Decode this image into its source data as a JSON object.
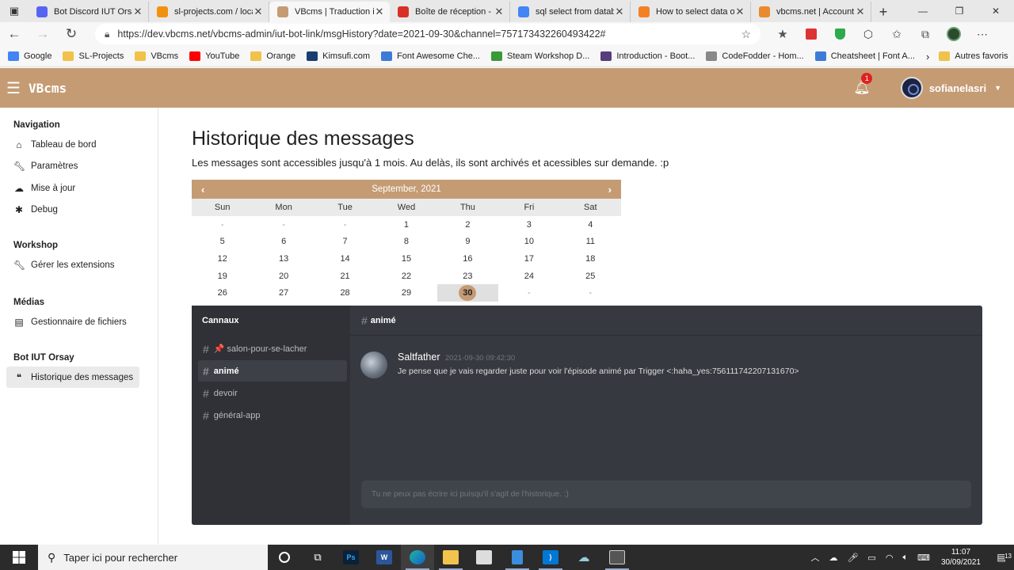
{
  "browser": {
    "tabs": [
      {
        "title": "Bot Discord IUT Orsay",
        "icon": "discord-icon",
        "color": "#5865f2",
        "active": false
      },
      {
        "title": "sl-projects.com / localhost",
        "icon": "phpmyadmin-icon",
        "color": "#f29111",
        "active": false
      },
      {
        "title": "VBcms | Traduction in",
        "icon": "vbcms-icon",
        "color": "#c59b74",
        "active": true
      },
      {
        "title": "Boîte de réception - a",
        "icon": "gmail-icon",
        "color": "#d93025",
        "active": false
      },
      {
        "title": "sql select from datab",
        "icon": "google-icon",
        "color": "#4285f4",
        "active": false
      },
      {
        "title": "How to select data of",
        "icon": "stackoverflow-icon",
        "color": "#f48024",
        "active": false
      },
      {
        "title": "vbcms.net | Account",
        "icon": "vbcms-net-icon",
        "color": "#e98a2f",
        "active": false
      }
    ],
    "url": "https://dev.vbcms.net/vbcms-admin/iut-bot-link/msgHistory?date=2021-09-30&channel=757173432260493422#",
    "bookmarks": [
      {
        "label": "Google",
        "icon": "google-icon"
      },
      {
        "label": "SL-Projects",
        "icon": "folder-icon"
      },
      {
        "label": "VBcms",
        "icon": "folder-icon"
      },
      {
        "label": "YouTube",
        "icon": "youtube-icon"
      },
      {
        "label": "Orange",
        "icon": "folder-icon"
      },
      {
        "label": "Kimsufi.com",
        "icon": "kimsufi-icon"
      },
      {
        "label": "Font Awesome Che...",
        "icon": "flag-icon"
      },
      {
        "label": "Steam Workshop D...",
        "icon": "steam-icon"
      },
      {
        "label": "Introduction - Boot...",
        "icon": "bootstrap-icon"
      },
      {
        "label": "CodeFodder - Hom...",
        "icon": "codefodder-icon"
      },
      {
        "label": "Cheatsheet | Font A...",
        "icon": "flag-icon"
      }
    ],
    "other_bookmarks": "Autres favoris"
  },
  "app": {
    "brand": "VBcms",
    "notification_count": "1",
    "username": "sofianelasri",
    "accent_color": "#c59b74"
  },
  "sidebar": {
    "sections": [
      {
        "title": "Navigation",
        "items": [
          {
            "label": "Tableau de bord",
            "icon": "home-icon"
          },
          {
            "label": "Paramètres",
            "icon": "wrench-icon"
          },
          {
            "label": "Mise à jour",
            "icon": "cloud-download-icon"
          },
          {
            "label": "Debug",
            "icon": "bug-icon"
          }
        ]
      },
      {
        "title": "Workshop",
        "items": [
          {
            "label": "Gérer les extensions",
            "icon": "wrench-icon"
          }
        ]
      },
      {
        "title": "Médias",
        "items": [
          {
            "label": "Gestionnaire de fichiers",
            "icon": "images-icon"
          }
        ]
      },
      {
        "title": "Bot IUT Orsay",
        "items": [
          {
            "label": "Historique des messages",
            "icon": "comments-icon",
            "active": true
          }
        ]
      }
    ]
  },
  "page": {
    "title": "Historique des messages",
    "subtitle": "Les messages sont accessibles jusqu'à 1 mois. Au delàs, ils sont archivés et acessibles sur demande. :p"
  },
  "calendar": {
    "month_label": "September, 2021",
    "prev": "‹",
    "next": "›",
    "weekdays": [
      "Sun",
      "Mon",
      "Tue",
      "Wed",
      "Thu",
      "Fri",
      "Sat"
    ],
    "cells": [
      "-",
      "-",
      "-",
      "1",
      "2",
      "3",
      "4",
      "5",
      "6",
      "7",
      "8",
      "9",
      "10",
      "11",
      "12",
      "13",
      "14",
      "15",
      "16",
      "17",
      "18",
      "19",
      "20",
      "21",
      "22",
      "23",
      "24",
      "25",
      "26",
      "27",
      "28",
      "29",
      "30",
      "-",
      "-"
    ],
    "selected": "30"
  },
  "discord": {
    "channels_title": "Cannaux",
    "channels": [
      {
        "name": "📌 salon-pour-se-lacher",
        "active": false
      },
      {
        "name": "animé",
        "active": true
      },
      {
        "name": "devoir",
        "active": false
      },
      {
        "name": "général-app",
        "active": false
      }
    ],
    "current_channel": "animé",
    "messages": [
      {
        "author": "Saltfather",
        "time": "2021-09-30 09:42:30",
        "text": "Je pense que je vais regarder juste pour voir l'épisode animé par Trigger <:haha_yes:756111742207131670>"
      }
    ],
    "input_placeholder": "Tu ne peux pas écrire ici puisqu'il s'agit de l'historique. :)"
  },
  "taskbar": {
    "search_placeholder": "Taper ici pour rechercher",
    "apps": [
      "cortana-icon",
      "task-view-icon",
      "photoshop-icon",
      "word-icon",
      "edge-icon",
      "file-explorer-icon",
      "store-icon",
      "phone-icon",
      "vscode-icon",
      "onedrive-app-icon",
      "image-viewer-icon"
    ],
    "time": "11:07",
    "date": "30/09/2021",
    "notifications": "13"
  }
}
